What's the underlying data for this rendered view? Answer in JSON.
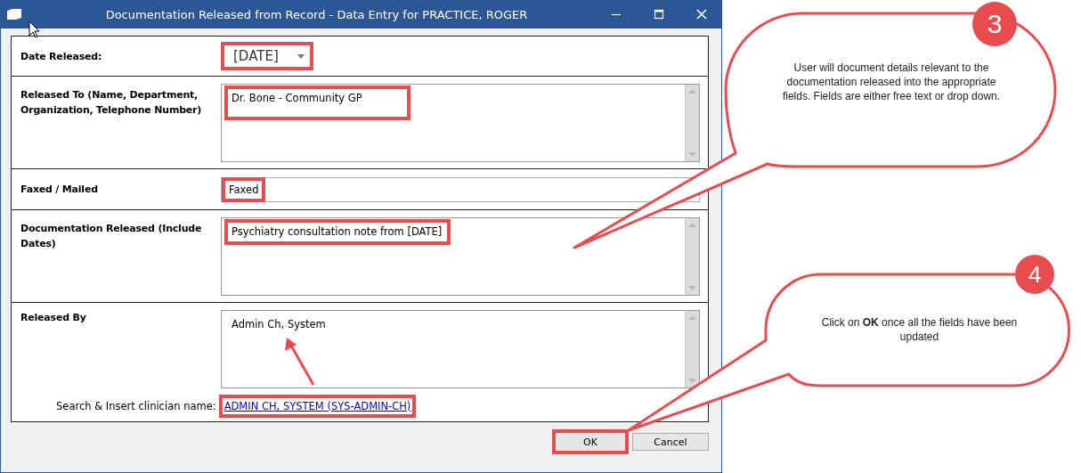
{
  "window": {
    "title": "Documentation Released from Record - Data Entry for PRACTICE, ROGER"
  },
  "fields": [
    {
      "kind": "date",
      "label": "Date Released:",
      "value": "[DATE]",
      "highlighted": true
    },
    {
      "kind": "textarea",
      "label": "Released To (Name, Department, Organization, Telephone Number)",
      "value": "Dr. Bone - Community GP",
      "highlighted": true
    },
    {
      "kind": "dropdown",
      "label": "Faxed / Mailed",
      "value": "Faxed",
      "highlighted": true
    },
    {
      "kind": "textarea",
      "label": "Documentation Released (Include Dates)",
      "value": "Psychiatry consultation note from [DATE]",
      "highlighted": true
    },
    {
      "kind": "textarea",
      "label": "Released By",
      "value": "Admin Ch, System",
      "highlighted": false,
      "search": {
        "label": "Search & Insert clinician name:",
        "link": "ADMIN CH, SYSTEM (SYS-ADMIN-CH)",
        "highlighted": true
      }
    }
  ],
  "buttons": [
    {
      "label": "OK",
      "highlighted": true
    },
    {
      "label": "Cancel",
      "highlighted": false
    }
  ],
  "callouts": [
    {
      "number": "3",
      "text": "User will document details relevant to the documentation released into the appropriate fields. Fields are either free text or drop down."
    },
    {
      "number": "4",
      "text": "Click on **OK** once all the fields have been updated"
    }
  ]
}
